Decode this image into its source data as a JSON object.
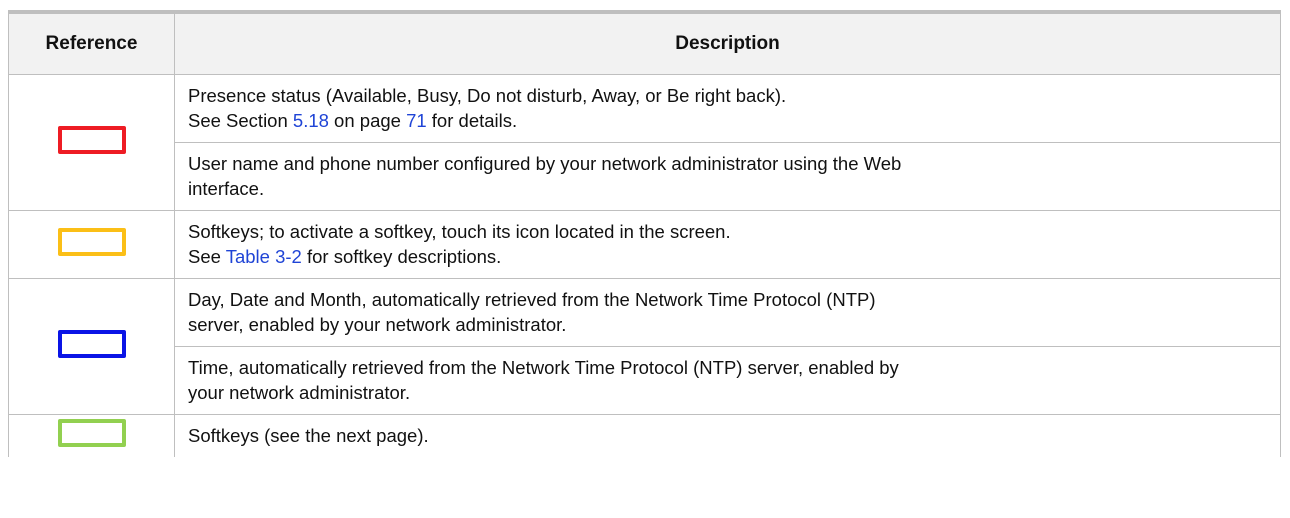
{
  "table": {
    "headers": {
      "reference": "Reference",
      "description": "Description"
    },
    "swatches": {
      "red": "#ee1c24",
      "yellow": "#fbbf17",
      "blue": "#0a14e6",
      "green": "#92d050"
    },
    "rows": {
      "presence": {
        "line1": "Presence status (Available, Busy, Do not disturb, Away, or Be right back).",
        "line2_before": "See Section ",
        "line2_section_link": "5.18",
        "line2_middle": " on page ",
        "line2_page_link": "71",
        "line2_after": " for details."
      },
      "username": {
        "line1": "User name and phone number configured by your network administrator using the Web",
        "line2": "interface."
      },
      "softkeys": {
        "line1": "Softkeys; to activate a softkey, touch its icon located in the screen.",
        "line2_before": "See ",
        "line2_table_link": "Table 3-2",
        "line2_after": " for softkey descriptions."
      },
      "date": {
        "line1": "Day, Date and Month, automatically retrieved from the Network Time Protocol (NTP)",
        "line2": "server, enabled by your network administrator."
      },
      "time": {
        "line1": "Time, automatically retrieved from the Network Time Protocol (NTP) server, enabled by",
        "line2": "your network administrator."
      },
      "more_softkeys": {
        "line1": "Softkeys (see the next page)."
      }
    }
  }
}
